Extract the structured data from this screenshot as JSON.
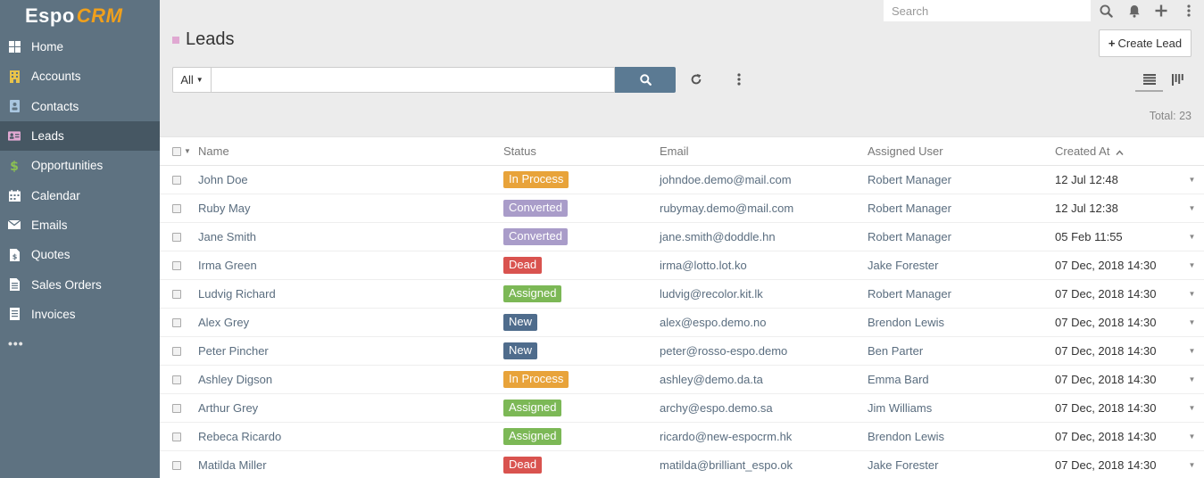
{
  "app": {
    "logo_espo": "Espo",
    "logo_crm": "CRM"
  },
  "nav": [
    {
      "label": "Home",
      "icon": "th-large-icon",
      "active": false,
      "color": "#ffffff"
    },
    {
      "label": "Accounts",
      "icon": "building-icon",
      "active": false,
      "color": "#e8c34a"
    },
    {
      "label": "Contacts",
      "icon": "contact-card-icon",
      "active": false,
      "color": "#a9c6e0"
    },
    {
      "label": "Leads",
      "icon": "address-card-icon",
      "active": true,
      "color": "#e0a8d2"
    },
    {
      "label": "Opportunities",
      "icon": "dollar-icon",
      "active": false,
      "color": "#8cc152"
    },
    {
      "label": "Calendar",
      "icon": "calendar-icon",
      "active": false,
      "color": "#ffffff"
    },
    {
      "label": "Emails",
      "icon": "envelope-icon",
      "active": false,
      "color": "#ffffff"
    },
    {
      "label": "Quotes",
      "icon": "file-dollar-icon",
      "active": false,
      "color": "#ffffff"
    },
    {
      "label": "Sales Orders",
      "icon": "file-lines-icon",
      "active": false,
      "color": "#ffffff"
    },
    {
      "label": "Invoices",
      "icon": "invoice-icon",
      "active": false,
      "color": "#ffffff"
    }
  ],
  "nav_more": "•••",
  "topbar": {
    "search_placeholder": "Search"
  },
  "page": {
    "title": "Leads",
    "create_label": "Create Lead",
    "filter_label": "All",
    "total": "Total: 23"
  },
  "table": {
    "headers": {
      "name": "Name",
      "status": "Status",
      "email": "Email",
      "assigned": "Assigned User",
      "created": "Created At"
    },
    "status_colors": {
      "In Process": "#e8a33a",
      "Converted": "#a99cc9",
      "Dead": "#d9534f",
      "Assigned": "#7cb856",
      "New": "#4f6c8c"
    },
    "rows": [
      {
        "name": "John Doe",
        "status": "In Process",
        "email": "johndoe.demo@mail.com",
        "assigned": "Robert Manager",
        "created": "12 Jul 12:48"
      },
      {
        "name": "Ruby May",
        "status": "Converted",
        "email": "rubymay.demo@mail.com",
        "assigned": "Robert Manager",
        "created": "12 Jul 12:38"
      },
      {
        "name": "Jane Smith",
        "status": "Converted",
        "email": "jane.smith@doddle.hn",
        "assigned": "Robert Manager",
        "created": "05 Feb 11:55"
      },
      {
        "name": "Irma Green",
        "status": "Dead",
        "email": "irma@lotto.lot.ko",
        "assigned": "Jake Forester",
        "created": "07 Dec, 2018 14:30"
      },
      {
        "name": "Ludvig Richard",
        "status": "Assigned",
        "email": "ludvig@recolor.kit.lk",
        "assigned": "Robert Manager",
        "created": "07 Dec, 2018 14:30"
      },
      {
        "name": "Alex Grey",
        "status": "New",
        "email": "alex@espo.demo.no",
        "assigned": "Brendon Lewis",
        "created": "07 Dec, 2018 14:30"
      },
      {
        "name": "Peter Pincher",
        "status": "New",
        "email": "peter@rosso-espo.demo",
        "assigned": "Ben Parter",
        "created": "07 Dec, 2018 14:30"
      },
      {
        "name": "Ashley Digson",
        "status": "In Process",
        "email": "ashley@demo.da.ta",
        "assigned": "Emma Bard",
        "created": "07 Dec, 2018 14:30"
      },
      {
        "name": "Arthur Grey",
        "status": "Assigned",
        "email": "archy@espo.demo.sa",
        "assigned": "Jim Williams",
        "created": "07 Dec, 2018 14:30"
      },
      {
        "name": "Rebeca Ricardo",
        "status": "Assigned",
        "email": "ricardo@new-espocrm.hk",
        "assigned": "Brendon Lewis",
        "created": "07 Dec, 2018 14:30"
      },
      {
        "name": "Matilda Miller",
        "status": "Dead",
        "email": "matilda@brilliant_espo.ok",
        "assigned": "Jake Forester",
        "created": "07 Dec, 2018 14:30"
      }
    ]
  }
}
